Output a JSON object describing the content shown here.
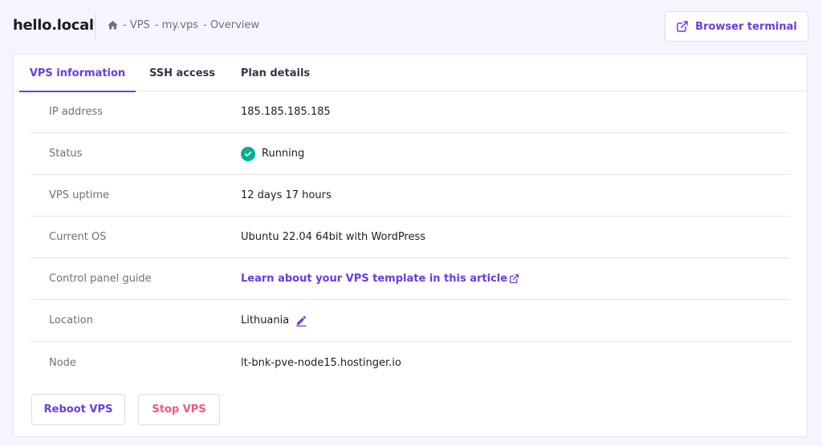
{
  "header": {
    "site_title": "hello.local",
    "breadcrumb": [
      "- VPS",
      "- my.vps",
      "- Overview"
    ],
    "terminal_button": "Browser terminal"
  },
  "tabs": [
    {
      "label": "VPS information",
      "active": true
    },
    {
      "label": "SSH access",
      "active": false
    },
    {
      "label": "Plan details",
      "active": false
    }
  ],
  "info": {
    "ip_label": "IP address",
    "ip_value": "185.185.185.185",
    "status_label": "Status",
    "status_value": "Running",
    "uptime_label": "VPS uptime",
    "uptime_value": "12 days 17 hours",
    "os_label": "Current OS",
    "os_value": "Ubuntu 22.04 64bit with WordPress",
    "guide_label": "Control panel guide",
    "guide_link": "Learn about your VPS template in this article",
    "location_label": "Location",
    "location_value": "Lithuania",
    "node_label": "Node",
    "node_value": "lt-bnk-pve-node15.hostinger.io"
  },
  "actions": {
    "reboot": "Reboot VPS",
    "stop": "Stop VPS"
  },
  "icons": {
    "home": "home-icon",
    "external": "external-link-icon",
    "status": "check-circle-icon",
    "edit": "pencil-icon"
  },
  "colors": {
    "accent": "#673de6",
    "success": "#00b090",
    "danger": "#fc5185"
  }
}
